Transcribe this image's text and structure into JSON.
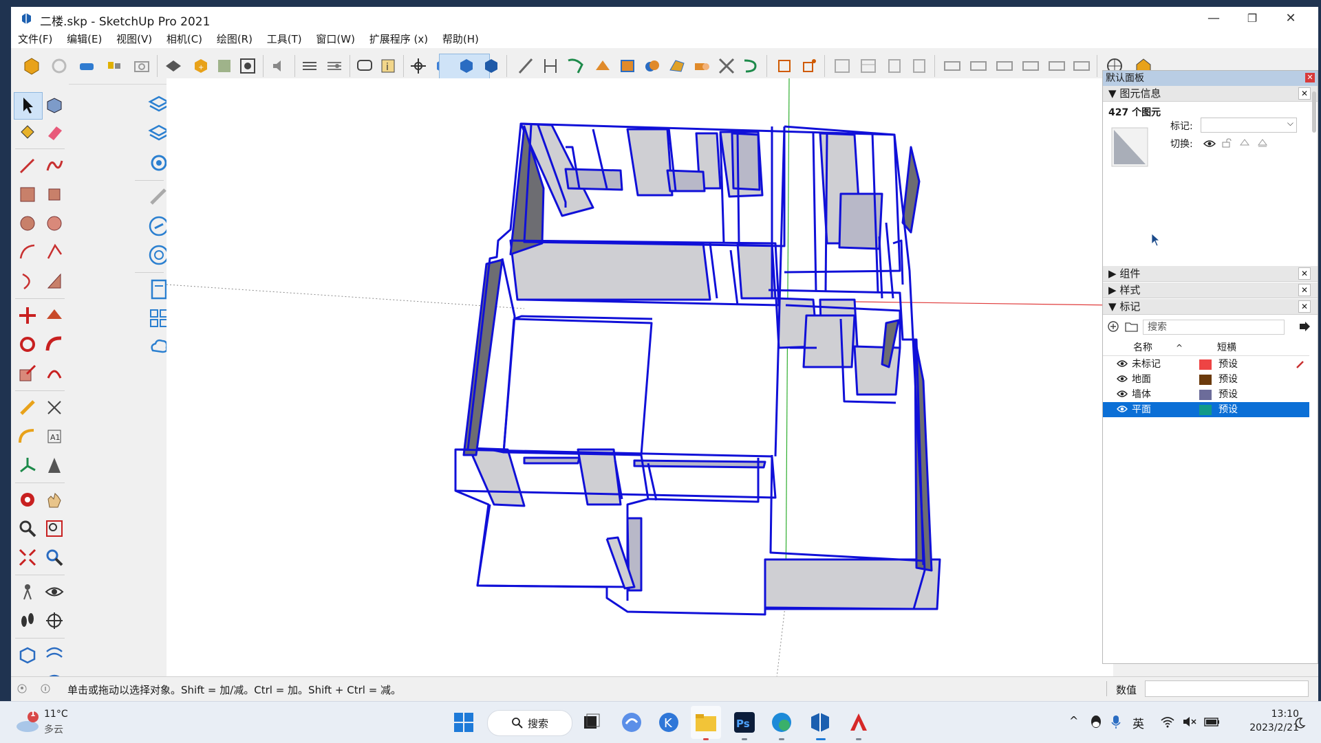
{
  "window": {
    "title": "二楼.skp - SketchUp Pro 2021",
    "minimize": "—",
    "maximize": "❐",
    "close": "✕"
  },
  "menu": [
    "文件(F)",
    "编辑(E)",
    "视图(V)",
    "相机(C)",
    "绘图(R)",
    "工具(T)",
    "窗口(W)",
    "扩展程序 (x)",
    "帮助(H)"
  ],
  "panel": {
    "title": "默认面板",
    "entity_info": {
      "header": "图元信息",
      "count": "427 个图元",
      "tag_label": "标记:",
      "toggle_label": "切换:"
    },
    "components_header": "组件",
    "styles_header": "样式",
    "tags": {
      "header": "标记",
      "search_placeholder": "搜索",
      "col_name": "名称",
      "col_dash": "短横",
      "rows": [
        {
          "name": "未标记",
          "color": "#ee4444",
          "dash": "预设",
          "selected": false
        },
        {
          "name": "地面",
          "color": "#6b3a0c",
          "dash": "预设",
          "selected": false
        },
        {
          "name": "墙体",
          "color": "#6c6c9a",
          "dash": "预设",
          "selected": false
        },
        {
          "name": "平面",
          "color": "#119a88",
          "dash": "预设",
          "selected": true
        }
      ]
    }
  },
  "status": {
    "hint": "单击或拖动以选择对象。Shift = 加/减。Ctrl = 加。Shift + Ctrl = 减。",
    "vcb_label": "数值"
  },
  "taskbar": {
    "weather_temp": "11°C",
    "weather_desc": "多云",
    "weather_badge": "1",
    "search_label": "搜索",
    "ime": "英",
    "time": "13:10",
    "date": "2023/2/21"
  },
  "colors": {
    "model_edge": "#1010d8",
    "selection": "#0b6fd6",
    "axis_red": "#e03c3c",
    "axis_green": "#2fae2f"
  }
}
